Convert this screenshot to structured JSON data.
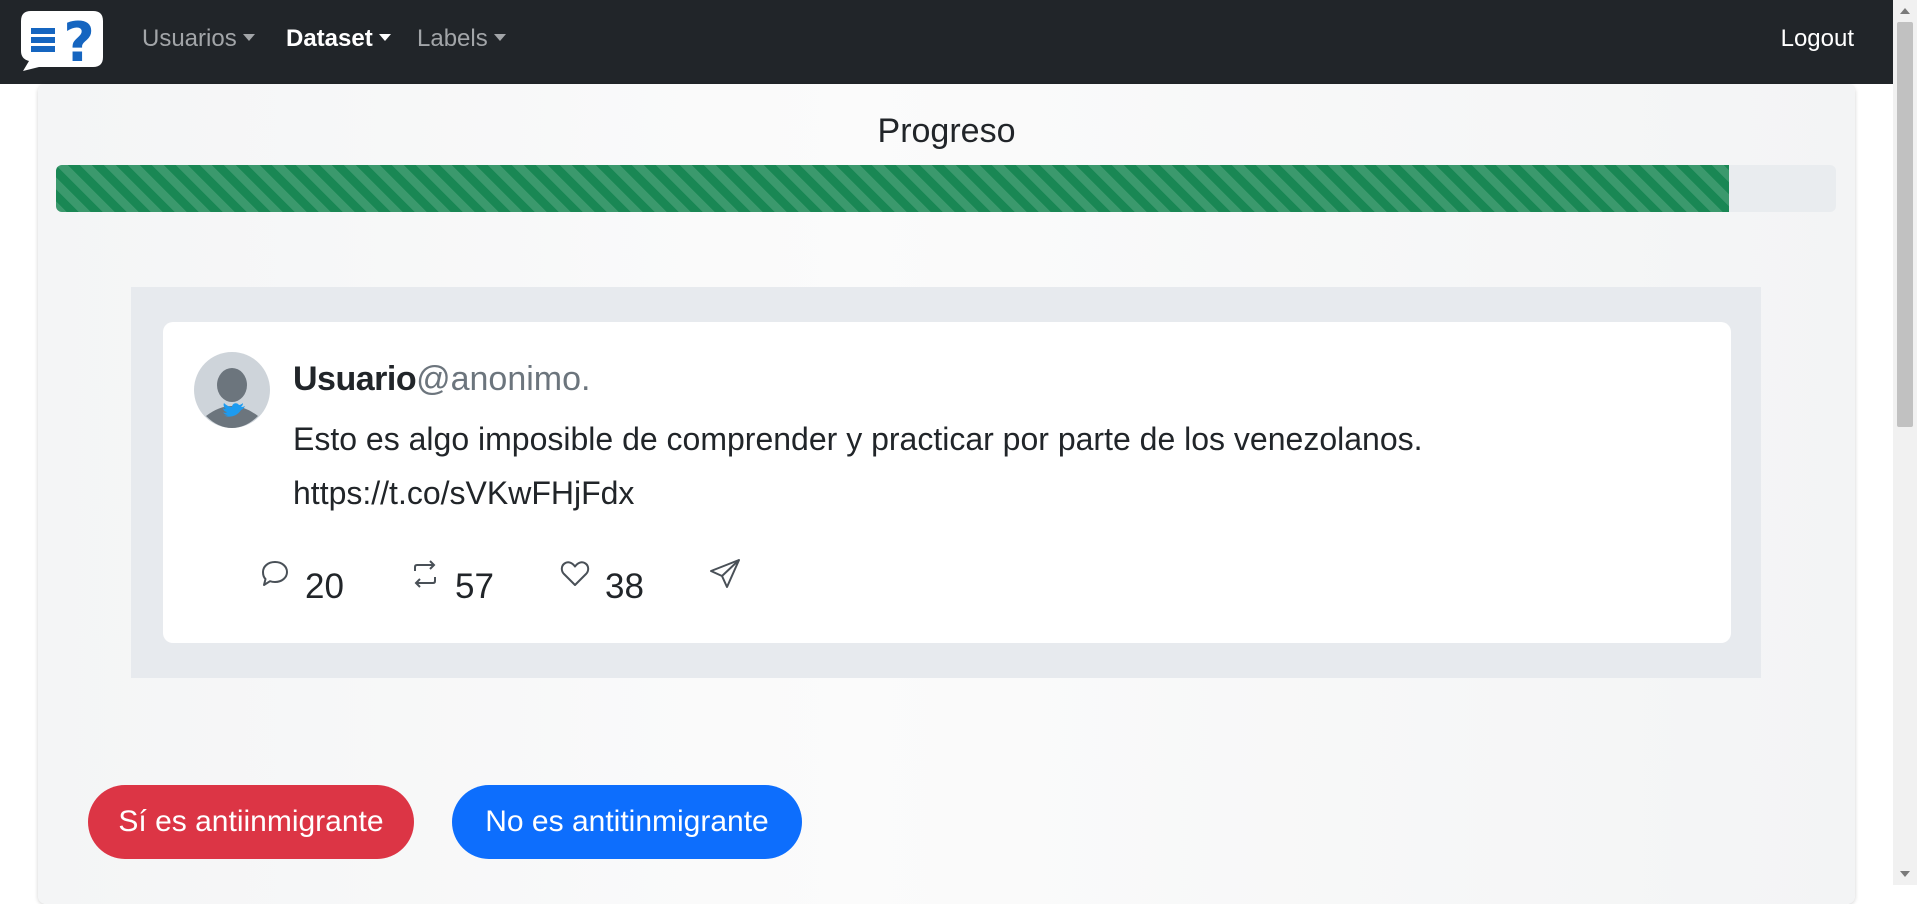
{
  "navbar": {
    "brand_icon": "chat-question-logo",
    "menus": [
      {
        "label": "Usuarios",
        "active": false
      },
      {
        "label": "Dataset",
        "active": true
      },
      {
        "label": "Labels",
        "active": false
      }
    ],
    "logout_label": "Logout"
  },
  "progress": {
    "title": "Progreso",
    "value_fraction": 0.94,
    "color": "#198754"
  },
  "tweet": {
    "avatar_icon": "twitter-user-avatar",
    "user_name": "Usuario",
    "user_handle": "@anonimo.",
    "text": "Esto es algo imposible de comprender y practicar por parte de los venezolanos. https://t.co/sVKwFHjFdx",
    "actions": {
      "reply_count": "20",
      "retweet_count": "57",
      "like_count": "38"
    }
  },
  "buttons": {
    "yes_label": "Sí es antiinmigrante",
    "no_label": "No es antitinmigrante",
    "yes_color": "#dc3545",
    "no_color": "#0d6efd"
  }
}
